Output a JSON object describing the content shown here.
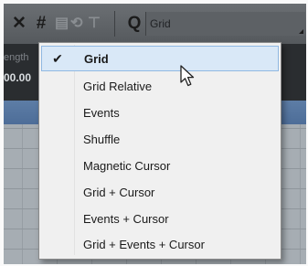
{
  "toolbar": {
    "snap_icon": "snap-toggle-icon",
    "grid_icon": "snap-type-icon",
    "quantize_icon": "quantize-icon",
    "quantize_value": "Grid"
  },
  "info": {
    "length_label": "ength",
    "length_value": "00.00"
  },
  "menu": {
    "items": [
      {
        "label": "Grid",
        "selected": true
      },
      {
        "label": "Grid Relative",
        "selected": false
      },
      {
        "label": "Events",
        "selected": false
      },
      {
        "label": "Shuffle",
        "selected": false
      },
      {
        "label": "Magnetic Cursor",
        "selected": false
      },
      {
        "label": "Grid + Cursor",
        "selected": false
      },
      {
        "label": "Events + Cursor",
        "selected": false
      },
      {
        "label": "Grid + Events + Cursor",
        "selected": false
      }
    ],
    "check_glyph": "✔"
  },
  "colors": {
    "menu_highlight": "#d9e8f7",
    "menu_highlight_border": "#90b8e2",
    "toolbar": "#5f6367"
  }
}
